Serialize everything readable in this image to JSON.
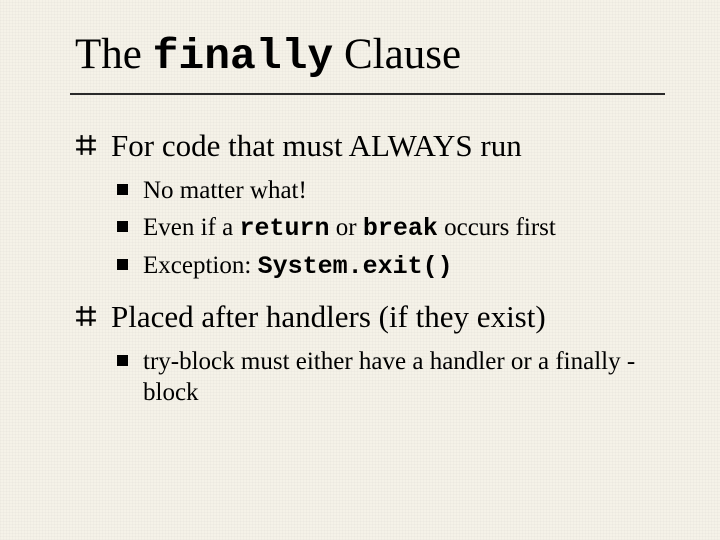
{
  "title": {
    "pre": "The ",
    "mono": "finally",
    "post": " Clause"
  },
  "bullets": [
    {
      "runs": [
        {
          "text": "For code that must ALWAYS run",
          "mono": false
        }
      ],
      "children": [
        {
          "runs": [
            {
              "text": "No matter what!",
              "mono": false
            }
          ]
        },
        {
          "runs": [
            {
              "text": "Even if a ",
              "mono": false
            },
            {
              "text": "return",
              "mono": true
            },
            {
              "text": " or ",
              "mono": false
            },
            {
              "text": "break",
              "mono": true
            },
            {
              "text": " occurs first",
              "mono": false
            }
          ]
        },
        {
          "runs": [
            {
              "text": "Exception: ",
              "mono": false
            },
            {
              "text": "System.exit()",
              "mono": true
            }
          ]
        }
      ]
    },
    {
      "runs": [
        {
          "text": "Placed after handlers (if they exist)",
          "mono": false
        }
      ],
      "children": [
        {
          "runs": [
            {
              "text": "try-block must either have a handler or a finally -block",
              "mono": false
            }
          ]
        }
      ]
    }
  ]
}
